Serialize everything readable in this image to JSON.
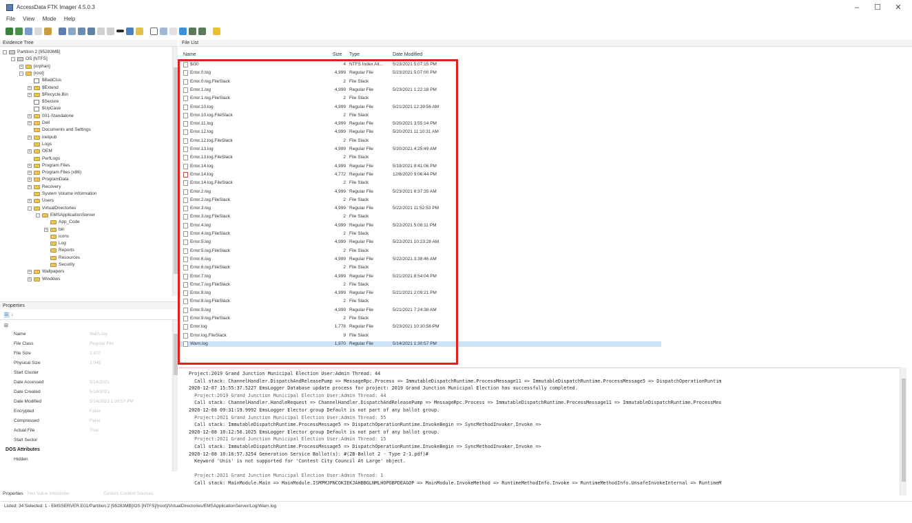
{
  "window": {
    "title": "AccessData FTK Imager 4.5.0.3",
    "minimize": "–",
    "maximize": "☐",
    "close": "✕"
  },
  "menu": [
    "File",
    "View",
    "Mode",
    "Help"
  ],
  "panes": {
    "evidence_tree": "Evidence Tree",
    "file_list": "File List",
    "properties": "Properties"
  },
  "tree": [
    {
      "label": "Partition 2 [95283MB]",
      "level": 0,
      "icon": "disk",
      "exp": "-"
    },
    {
      "label": "OS [NTFS]",
      "level": 1,
      "icon": "disk",
      "exp": "-"
    },
    {
      "label": "[orphan]",
      "level": 2,
      "icon": "folder",
      "exp": "+"
    },
    {
      "label": "[root]",
      "level": 2,
      "icon": "folder",
      "exp": "-"
    },
    {
      "label": "$BadClus",
      "level": 3,
      "icon": "file",
      "exp": ""
    },
    {
      "label": "$Extend",
      "level": 3,
      "icon": "folder",
      "exp": "+"
    },
    {
      "label": "$Recycle.Bin",
      "level": 3,
      "icon": "folder",
      "exp": "+"
    },
    {
      "label": "$Secure",
      "level": 3,
      "icon": "file",
      "exp": ""
    },
    {
      "label": "$UpCase",
      "level": 3,
      "icon": "file",
      "exp": ""
    },
    {
      "label": "001-Standalone",
      "level": 3,
      "icon": "folder",
      "exp": "+"
    },
    {
      "label": "Dell",
      "level": 3,
      "icon": "folder",
      "exp": "+"
    },
    {
      "label": "Documents and Settings",
      "level": 3,
      "icon": "folder",
      "exp": ""
    },
    {
      "label": "inetpub",
      "level": 3,
      "icon": "folder",
      "exp": "+"
    },
    {
      "label": "Logs",
      "level": 3,
      "icon": "folder",
      "exp": ""
    },
    {
      "label": "OEM",
      "level": 3,
      "icon": "folder",
      "exp": "+"
    },
    {
      "label": "PerfLogs",
      "level": 3,
      "icon": "folder",
      "exp": ""
    },
    {
      "label": "Program Files",
      "level": 3,
      "icon": "folder",
      "exp": "+"
    },
    {
      "label": "Program Files (x86)",
      "level": 3,
      "icon": "folder",
      "exp": "+"
    },
    {
      "label": "ProgramData",
      "level": 3,
      "icon": "folder",
      "exp": "+"
    },
    {
      "label": "Recovery",
      "level": 3,
      "icon": "folder",
      "exp": "+"
    },
    {
      "label": "System Volume Information",
      "level": 3,
      "icon": "folder",
      "exp": ""
    },
    {
      "label": "Users",
      "level": 3,
      "icon": "folder",
      "exp": "+"
    },
    {
      "label": "VirtualDirectories",
      "level": 3,
      "icon": "folder",
      "exp": "-"
    },
    {
      "label": "EMSApplicationServer",
      "level": 4,
      "icon": "folder",
      "exp": "-"
    },
    {
      "label": "App_Code",
      "level": 5,
      "icon": "folder",
      "exp": ""
    },
    {
      "label": "bin",
      "level": 5,
      "icon": "folder",
      "exp": "+"
    },
    {
      "label": "icons",
      "level": 5,
      "icon": "folder",
      "exp": ""
    },
    {
      "label": "Log",
      "level": 5,
      "icon": "folder",
      "exp": ""
    },
    {
      "label": "Reports",
      "level": 5,
      "icon": "folder",
      "exp": ""
    },
    {
      "label": "Resources",
      "level": 5,
      "icon": "folder",
      "exp": ""
    },
    {
      "label": "Security",
      "level": 5,
      "icon": "folder",
      "exp": ""
    },
    {
      "label": "Wallpapers",
      "level": 3,
      "icon": "folder",
      "exp": "+"
    },
    {
      "label": "Windows",
      "level": 3,
      "icon": "folder",
      "exp": "+"
    }
  ],
  "file_list": {
    "columns": {
      "name": "Name",
      "size": "Size",
      "type": "Type",
      "date": "Date Modified"
    },
    "rows": [
      {
        "name": "$I30",
        "size": "4",
        "type": "NTFS Index All...",
        "date": "5/23/2021 5:07:15 PM",
        "deleted": false
      },
      {
        "name": "Error.0.log",
        "size": "4,999",
        "type": "Regular File",
        "date": "5/23/2021 5:07:00 PM",
        "deleted": false
      },
      {
        "name": "Error.0.log.FileSlack",
        "size": "2",
        "type": "File Slack",
        "date": "",
        "deleted": false
      },
      {
        "name": "Error.1.log",
        "size": "4,999",
        "type": "Regular File",
        "date": "5/23/2021 1:22:18 PM",
        "deleted": false
      },
      {
        "name": "Error.1.log.FileSlack",
        "size": "2",
        "type": "File Slack",
        "date": "",
        "deleted": false
      },
      {
        "name": "Error.10.log",
        "size": "4,999",
        "type": "Regular File",
        "date": "5/21/2021 12:39:56 AM",
        "deleted": false
      },
      {
        "name": "Error.10.log.FileSlack",
        "size": "2",
        "type": "File Slack",
        "date": "",
        "deleted": false
      },
      {
        "name": "Error.11.log",
        "size": "4,999",
        "type": "Regular File",
        "date": "5/20/2021 3:55:14 PM",
        "deleted": false
      },
      {
        "name": "Error.12.log",
        "size": "4,999",
        "type": "Regular File",
        "date": "5/20/2021 11:10:31 AM",
        "deleted": false
      },
      {
        "name": "Error.12.log.FileSlack",
        "size": "2",
        "type": "File Slack",
        "date": "",
        "deleted": false
      },
      {
        "name": "Error.13.log",
        "size": "4,999",
        "type": "Regular File",
        "date": "5/20/2021 4:25:49 AM",
        "deleted": false
      },
      {
        "name": "Error.13.log.FileSlack",
        "size": "2",
        "type": "File Slack",
        "date": "",
        "deleted": false
      },
      {
        "name": "Error.14.log",
        "size": "4,999",
        "type": "Regular File",
        "date": "5/19/2021 9:41:06 PM",
        "deleted": false
      },
      {
        "name": "Error.14.log",
        "size": "4,772",
        "type": "Regular File",
        "date": "12/8/2020 9:06:44 PM",
        "deleted": true
      },
      {
        "name": "Error.14.log.FileSlack",
        "size": "2",
        "type": "File Slack",
        "date": "",
        "deleted": false
      },
      {
        "name": "Error.2.log",
        "size": "4,999",
        "type": "Regular File",
        "date": "5/23/2021 6:37:35 AM",
        "deleted": false
      },
      {
        "name": "Error.2.log.FileSlack",
        "size": "2",
        "type": "File Slack",
        "date": "",
        "deleted": false
      },
      {
        "name": "Error.3.log",
        "size": "4,999",
        "type": "Regular File",
        "date": "5/22/2021 11:52:53 PM",
        "deleted": false
      },
      {
        "name": "Error.3.log.FileSlack",
        "size": "2",
        "type": "File Slack",
        "date": "",
        "deleted": false
      },
      {
        "name": "Error.4.log",
        "size": "4,999",
        "type": "Regular File",
        "date": "5/22/2021 5:08:11 PM",
        "deleted": false
      },
      {
        "name": "Error.4.log.FileSlack",
        "size": "2",
        "type": "File Slack",
        "date": "",
        "deleted": false
      },
      {
        "name": "Error.5.log",
        "size": "4,999",
        "type": "Regular File",
        "date": "5/22/2021 10:23:28 AM",
        "deleted": false
      },
      {
        "name": "Error.5.log.FileSlack",
        "size": "2",
        "type": "File Slack",
        "date": "",
        "deleted": false
      },
      {
        "name": "Error.6.log",
        "size": "4,999",
        "type": "Regular File",
        "date": "5/22/2021 3:38:46 AM",
        "deleted": false
      },
      {
        "name": "Error.6.log.FileSlack",
        "size": "2",
        "type": "File Slack",
        "date": "",
        "deleted": false
      },
      {
        "name": "Error.7.log",
        "size": "4,999",
        "type": "Regular File",
        "date": "5/21/2021 8:54:04 PM",
        "deleted": false
      },
      {
        "name": "Error.7.log.FileSlack",
        "size": "2",
        "type": "File Slack",
        "date": "",
        "deleted": false
      },
      {
        "name": "Error.8.log",
        "size": "4,999",
        "type": "Regular File",
        "date": "5/21/2021 2:09:21 PM",
        "deleted": false
      },
      {
        "name": "Error.8.log.FileSlack",
        "size": "2",
        "type": "File Slack",
        "date": "",
        "deleted": false
      },
      {
        "name": "Error.9.log",
        "size": "4,999",
        "type": "Regular File",
        "date": "5/21/2021 7:24:38 AM",
        "deleted": false
      },
      {
        "name": "Error.9.log.FileSlack",
        "size": "2",
        "type": "File Slack",
        "date": "",
        "deleted": false
      },
      {
        "name": "Error.log",
        "size": "1,778",
        "type": "Regular File",
        "date": "5/23/2021 10:30:56 PM",
        "deleted": false
      },
      {
        "name": "Error.log.FileSlack",
        "size": "9",
        "type": "File Slack",
        "date": "",
        "deleted": false
      },
      {
        "name": "Warn.log",
        "size": "1,970",
        "type": "Regular File",
        "date": "5/14/2021 1:30:57 PM",
        "deleted": false,
        "selected": true
      }
    ]
  },
  "properties": {
    "rows": [
      {
        "name": "Name",
        "value": "Warn.log"
      },
      {
        "name": "File Class",
        "value": "Regular File"
      },
      {
        "name": "File Size",
        "value": "1,970"
      },
      {
        "name": "Physical Size",
        "value": "2,048"
      },
      {
        "name": "Start Cluster",
        "value": ""
      },
      {
        "name": "Date Accessed",
        "value": "5/14/2021"
      },
      {
        "name": "Date Created",
        "value": "5/14/2021"
      },
      {
        "name": "Date Modified",
        "value": "5/14/2021 1:30:57 PM"
      },
      {
        "name": "Encrypted",
        "value": "False"
      },
      {
        "name": "Compressed",
        "value": "False"
      },
      {
        "name": "Actual File",
        "value": "True"
      },
      {
        "name": "Start Sector",
        "value": ""
      }
    ],
    "section": "DOS Attributes",
    "last_row": "Hidden",
    "footer_tabs": [
      "Properties",
      "Hex Value Interpreter",
      "Custom Content Sources"
    ]
  },
  "log_lines": [
    "Project:2019 Grand Junction Municipal Election User:Admin Thread: 44",
    "  Call stack: ChannelHandler.DispatchAndReleasePump => MessageRpc.Process => ImmutableDispatchRuntime.ProcessMessage11 => ImmutableDispatchRuntime.ProcessMessage5 => DispatchOperationRuntim",
    "2020-12-07 15:55:37.5227 EmsLogger Database update process for project: 2019 Grand Junction Municipal Election has successfully completed.",
    "  Project:2019 Grand Junction Municipal Election User:Admin Thread: 44",
    "  Call stack: ChannelHandler.HandleRequest => ChannelHandler.DispatchAndReleasePump => MessageRpc.Process => ImmutableDispatchRuntime.ProcessMessage11 => ImmutableDispatchRuntime.ProcessMes",
    "2020-12-08 09:31:19.9992 EmsLogger Elector group Default is not part of any ballot group.",
    "  Project:2021 Grand Junction Municipal Election User:Admin Thread: 55",
    "  Call stack: ImmutableDispatchRuntime.ProcessMessage5 => DispatchOperationRuntime.InvokeBegin => SyncMethodInvoker.Invoke =>",
    "2020-12-08 10:12:56.1025 EmsLogger Elector group Default is not part of any ballot group.",
    "  Project:2021 Grand Junction Municipal Election User:Admin Thread: 15",
    "  Call stack: ImmutableDispatchRuntime.ProcessMessage5 => DispatchOperationRuntime.InvokeBegin => SyncMethodInvoker.Invoke =>",
    "2020-12-08 10:16:57.3254 Generation Service Ballot(s): #(2B-Ballot 2 - Type 2-1.pdf)#",
    "  Keyword 'Unis' is not supported for 'Contest City Council At Large' object.",
    "",
    "  Project:2021 Grand Junction Municipal Election User:Admin Thread: 1",
    "  Call stack: MainModule.Main => MainModule.ISMPMJPNCOKIEKJAHBBGLNMLHOPOBPDEAGOP => MainModule.InvokeMethod => RuntimeMethodInfo.Invoke => RuntimeMethodInfo.UnsafeInvokeInternal => RuntimeM"
  ],
  "status": "Listed: 34  Selected: 1 - EMSSERVER.E01/Partition 2 [95283MB]/OS [NTFS]/[root]/VirtualDirectories/EMSApplicationServer/Log/Warn.log",
  "accent_highlight": "#e0211d"
}
